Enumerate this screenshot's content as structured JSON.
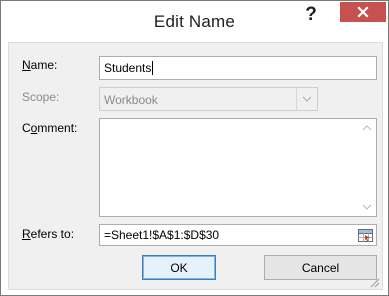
{
  "dialog": {
    "title": "Edit Name",
    "help_glyph": "?",
    "close_icon": "close-icon"
  },
  "fields": {
    "name": {
      "label_prefix": "",
      "label_accel": "N",
      "label_rest": "ame:",
      "value": "Students"
    },
    "scope": {
      "label": "Scope:",
      "value": "Workbook",
      "disabled": true
    },
    "comment": {
      "label_prefix": "C",
      "label_accel": "o",
      "label_rest": "mment:",
      "value": ""
    },
    "refers_to": {
      "label_prefix": "",
      "label_accel": "R",
      "label_rest": "efers to:",
      "value": "=Sheet1!$A$1:$D$30",
      "picker_icon": "range-selector-icon"
    }
  },
  "buttons": {
    "ok": "OK",
    "cancel": "Cancel"
  },
  "colors": {
    "close_button": "#c75050",
    "dialog_background": "#f0f0f0",
    "default_button_border": "#3c7fb1"
  }
}
